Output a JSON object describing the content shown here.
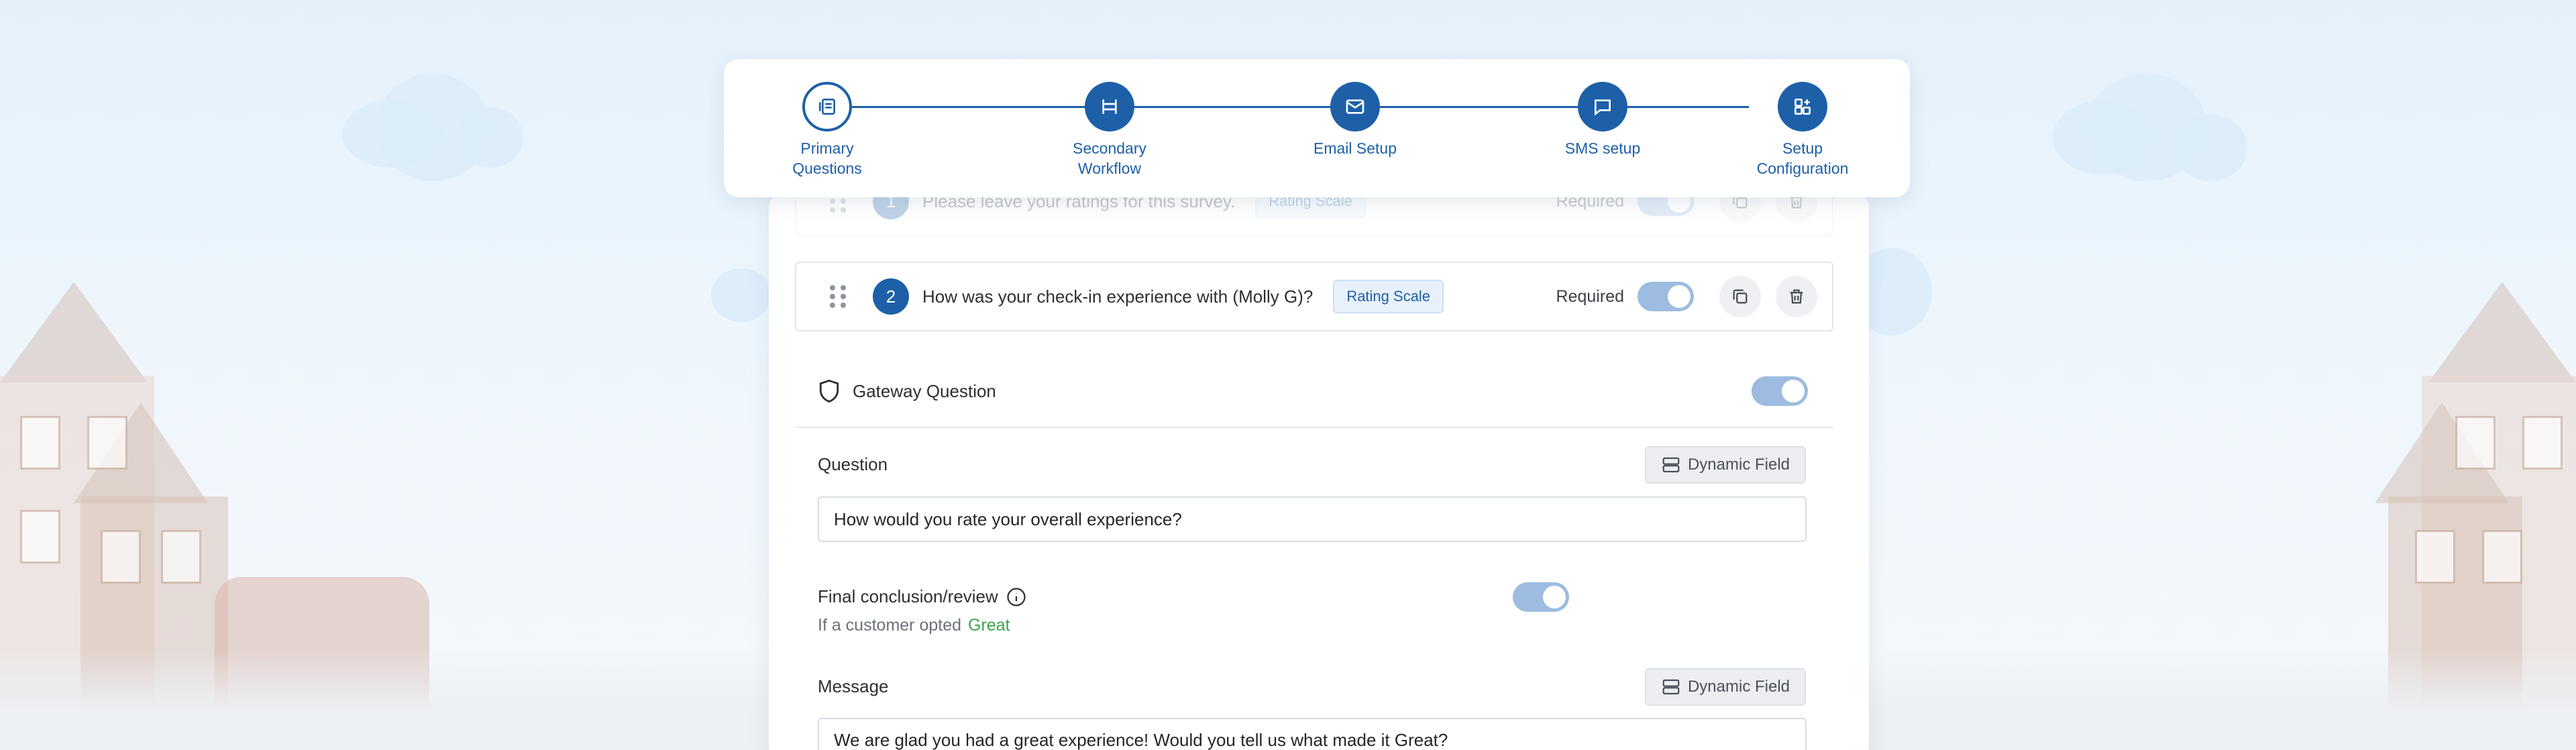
{
  "stepper": {
    "steps": [
      {
        "label": "Primary\nQuestions",
        "icon": "questions-icon",
        "state": "current"
      },
      {
        "label": "Secondary\nWorkflow",
        "icon": "workflow-icon",
        "state": "done"
      },
      {
        "label": "Email Setup",
        "icon": "envelope-icon",
        "state": "done"
      },
      {
        "label": "SMS setup",
        "icon": "chat-bubble-icon",
        "state": "done"
      },
      {
        "label": "Setup\nConfiguration",
        "icon": "config-icon",
        "state": "done"
      }
    ]
  },
  "questions": [
    {
      "number": "1",
      "text": "Please leave your ratings for this survey.",
      "type": "Rating Scale",
      "required_label": "Required"
    },
    {
      "number": "2",
      "text": "How was your check-in experience with (Molly G)?",
      "type": "Rating Scale",
      "required_label": "Required"
    }
  ],
  "gateway": {
    "label": "Gateway Question",
    "enabled": true
  },
  "question_field": {
    "label": "Question",
    "dynamic_button": "Dynamic Field",
    "value": "How would you rate your overall experience?"
  },
  "final_conclusion": {
    "label": "Final conclusion/review",
    "enabled": true,
    "condition_text": "If a customer opted",
    "condition_value": "Great"
  },
  "message_field": {
    "label": "Message",
    "dynamic_button": "Dynamic Field",
    "value": "We are glad you had a great experience! Would you tell us what made it Great?"
  },
  "colors": {
    "accent": "#1d60a8",
    "toggle_on": "#9dbce0",
    "great": "#3aa44b"
  }
}
